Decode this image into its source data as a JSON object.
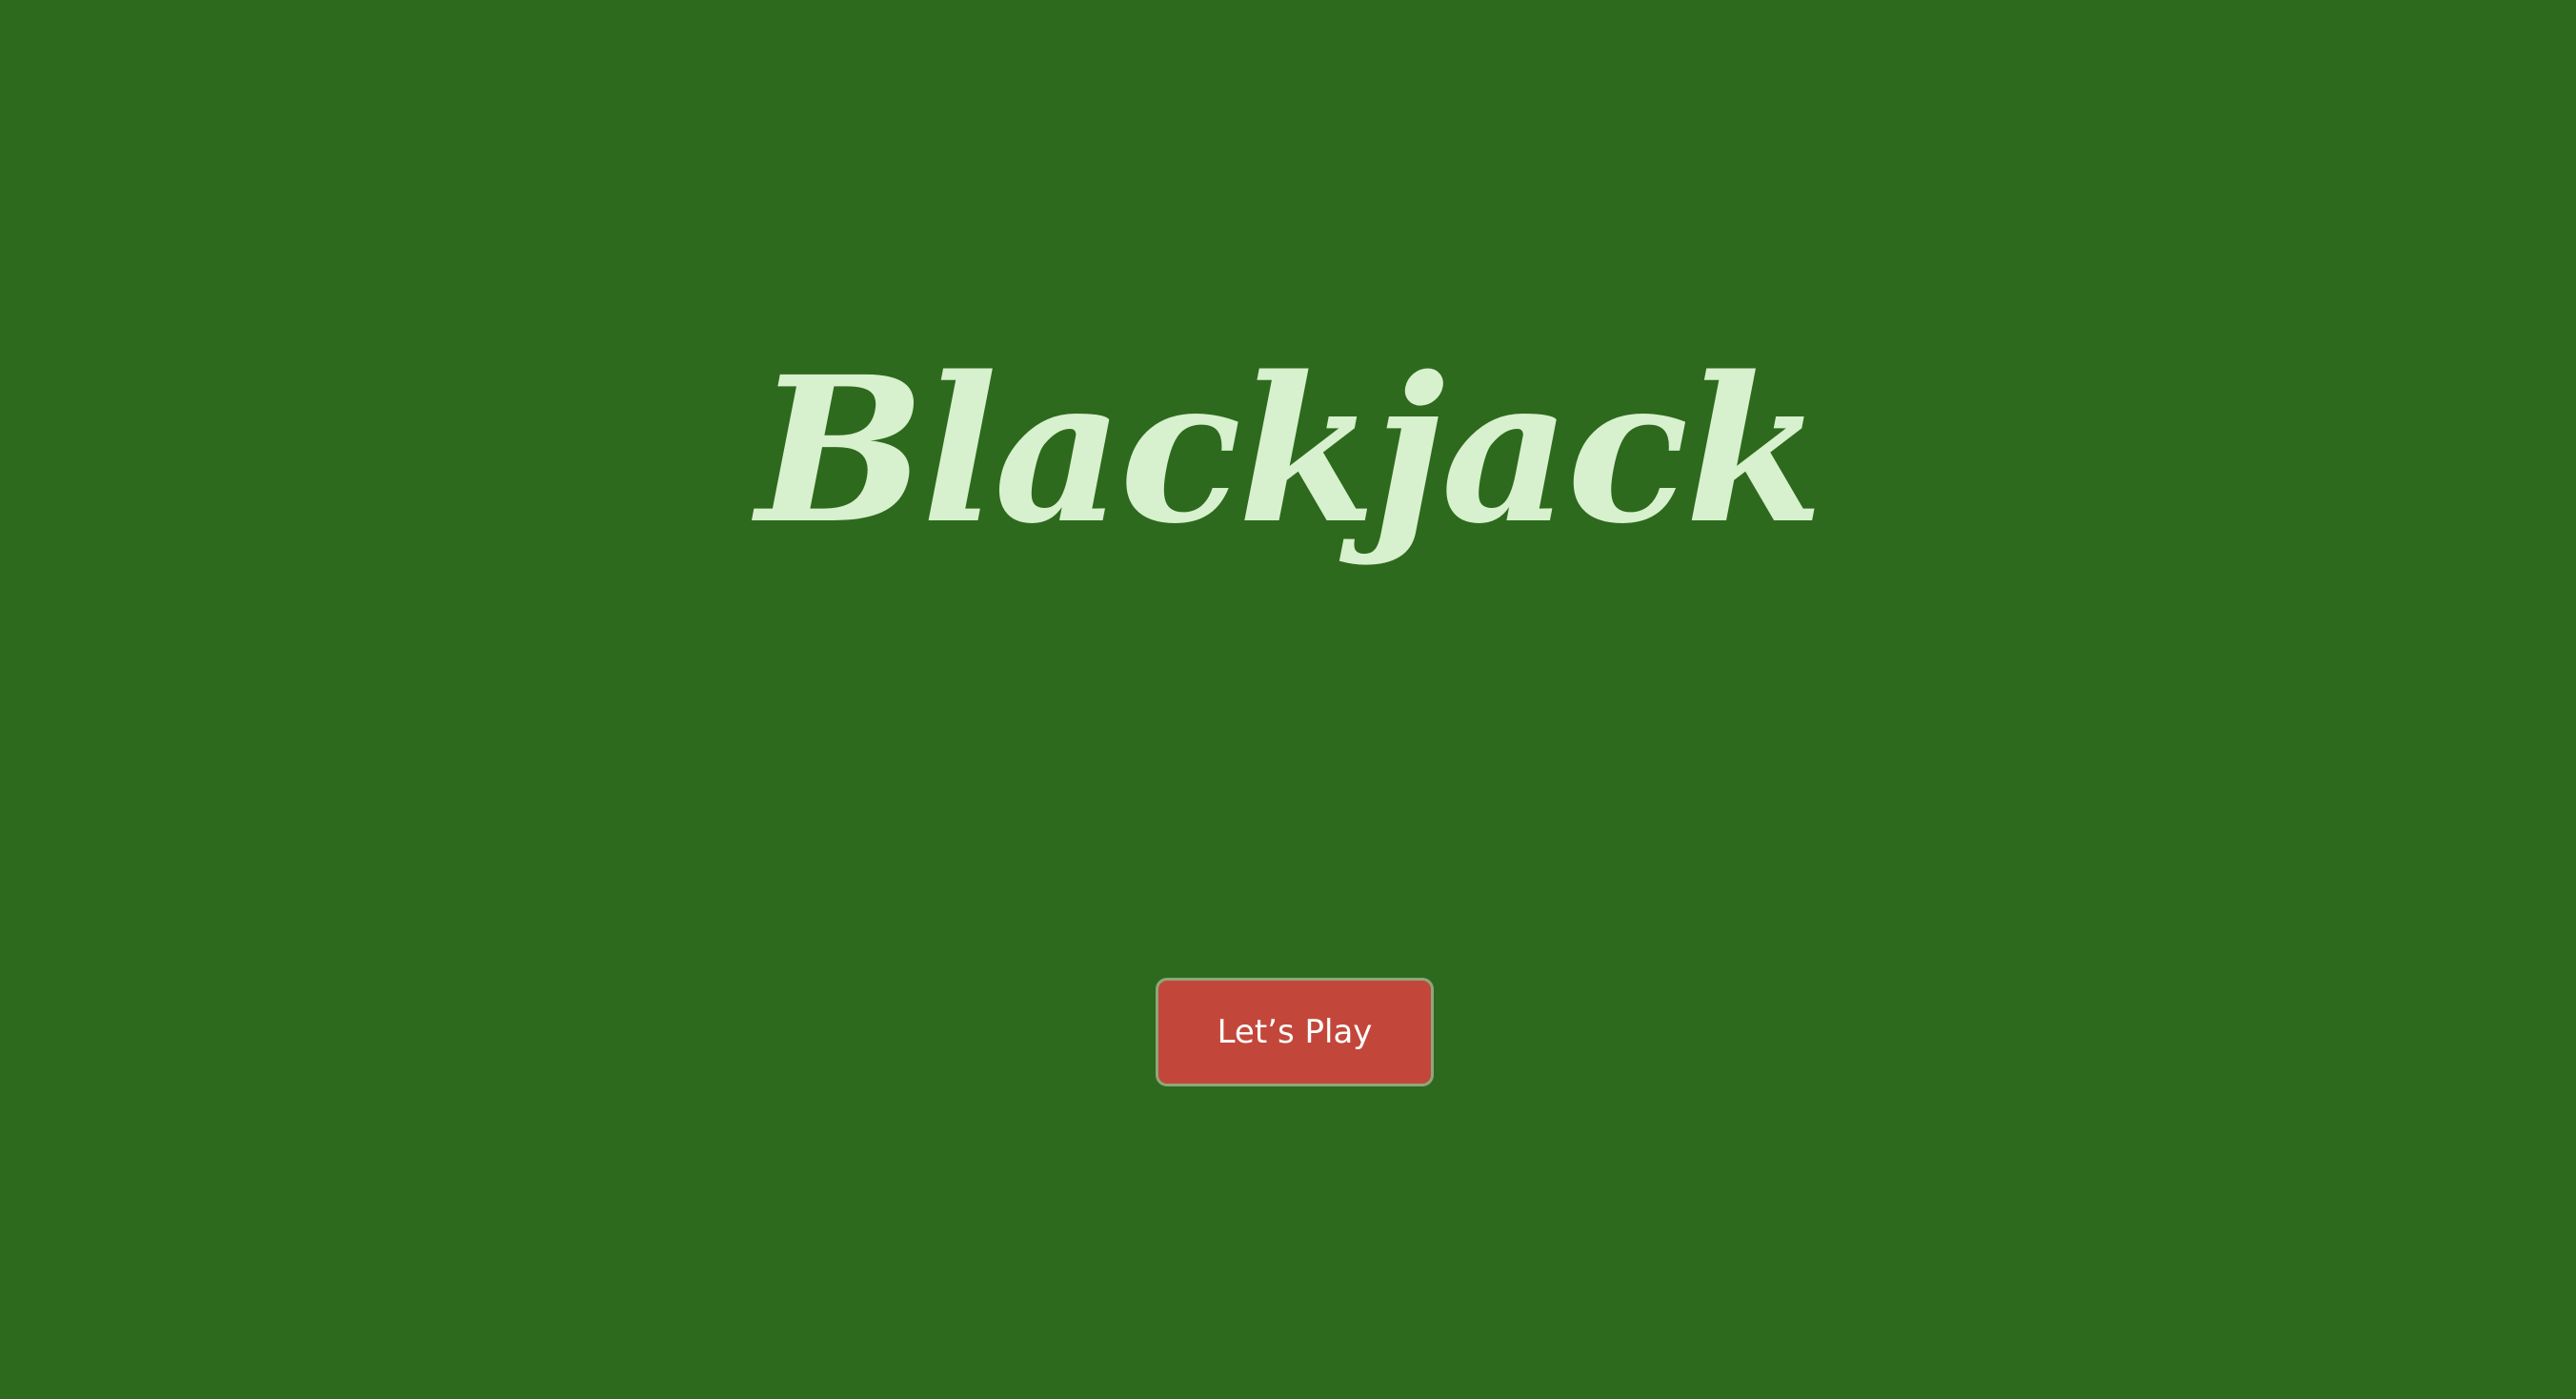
{
  "title": "Blackjack",
  "start_button_label": "Let’s Play",
  "colors": {
    "felt_background": "#2d6a1d",
    "title_text": "#d7f0cd",
    "button_background": "#c2473a",
    "button_border": "#8fa67c",
    "button_text": "#ffffff"
  }
}
